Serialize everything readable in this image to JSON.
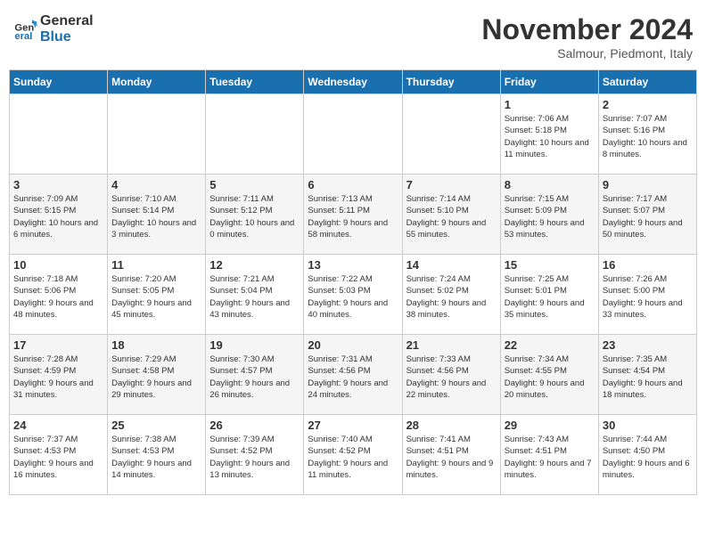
{
  "logo": {
    "line1": "General",
    "line2": "Blue"
  },
  "title": "November 2024",
  "location": "Salmour, Piedmont, Italy",
  "weekdays": [
    "Sunday",
    "Monday",
    "Tuesday",
    "Wednesday",
    "Thursday",
    "Friday",
    "Saturday"
  ],
  "weeks": [
    [
      {
        "day": "",
        "info": ""
      },
      {
        "day": "",
        "info": ""
      },
      {
        "day": "",
        "info": ""
      },
      {
        "day": "",
        "info": ""
      },
      {
        "day": "",
        "info": ""
      },
      {
        "day": "1",
        "info": "Sunrise: 7:06 AM\nSunset: 5:18 PM\nDaylight: 10 hours and 11 minutes."
      },
      {
        "day": "2",
        "info": "Sunrise: 7:07 AM\nSunset: 5:16 PM\nDaylight: 10 hours and 8 minutes."
      }
    ],
    [
      {
        "day": "3",
        "info": "Sunrise: 7:09 AM\nSunset: 5:15 PM\nDaylight: 10 hours and 6 minutes."
      },
      {
        "day": "4",
        "info": "Sunrise: 7:10 AM\nSunset: 5:14 PM\nDaylight: 10 hours and 3 minutes."
      },
      {
        "day": "5",
        "info": "Sunrise: 7:11 AM\nSunset: 5:12 PM\nDaylight: 10 hours and 0 minutes."
      },
      {
        "day": "6",
        "info": "Sunrise: 7:13 AM\nSunset: 5:11 PM\nDaylight: 9 hours and 58 minutes."
      },
      {
        "day": "7",
        "info": "Sunrise: 7:14 AM\nSunset: 5:10 PM\nDaylight: 9 hours and 55 minutes."
      },
      {
        "day": "8",
        "info": "Sunrise: 7:15 AM\nSunset: 5:09 PM\nDaylight: 9 hours and 53 minutes."
      },
      {
        "day": "9",
        "info": "Sunrise: 7:17 AM\nSunset: 5:07 PM\nDaylight: 9 hours and 50 minutes."
      }
    ],
    [
      {
        "day": "10",
        "info": "Sunrise: 7:18 AM\nSunset: 5:06 PM\nDaylight: 9 hours and 48 minutes."
      },
      {
        "day": "11",
        "info": "Sunrise: 7:20 AM\nSunset: 5:05 PM\nDaylight: 9 hours and 45 minutes."
      },
      {
        "day": "12",
        "info": "Sunrise: 7:21 AM\nSunset: 5:04 PM\nDaylight: 9 hours and 43 minutes."
      },
      {
        "day": "13",
        "info": "Sunrise: 7:22 AM\nSunset: 5:03 PM\nDaylight: 9 hours and 40 minutes."
      },
      {
        "day": "14",
        "info": "Sunrise: 7:24 AM\nSunset: 5:02 PM\nDaylight: 9 hours and 38 minutes."
      },
      {
        "day": "15",
        "info": "Sunrise: 7:25 AM\nSunset: 5:01 PM\nDaylight: 9 hours and 35 minutes."
      },
      {
        "day": "16",
        "info": "Sunrise: 7:26 AM\nSunset: 5:00 PM\nDaylight: 9 hours and 33 minutes."
      }
    ],
    [
      {
        "day": "17",
        "info": "Sunrise: 7:28 AM\nSunset: 4:59 PM\nDaylight: 9 hours and 31 minutes."
      },
      {
        "day": "18",
        "info": "Sunrise: 7:29 AM\nSunset: 4:58 PM\nDaylight: 9 hours and 29 minutes."
      },
      {
        "day": "19",
        "info": "Sunrise: 7:30 AM\nSunset: 4:57 PM\nDaylight: 9 hours and 26 minutes."
      },
      {
        "day": "20",
        "info": "Sunrise: 7:31 AM\nSunset: 4:56 PM\nDaylight: 9 hours and 24 minutes."
      },
      {
        "day": "21",
        "info": "Sunrise: 7:33 AM\nSunset: 4:56 PM\nDaylight: 9 hours and 22 minutes."
      },
      {
        "day": "22",
        "info": "Sunrise: 7:34 AM\nSunset: 4:55 PM\nDaylight: 9 hours and 20 minutes."
      },
      {
        "day": "23",
        "info": "Sunrise: 7:35 AM\nSunset: 4:54 PM\nDaylight: 9 hours and 18 minutes."
      }
    ],
    [
      {
        "day": "24",
        "info": "Sunrise: 7:37 AM\nSunset: 4:53 PM\nDaylight: 9 hours and 16 minutes."
      },
      {
        "day": "25",
        "info": "Sunrise: 7:38 AM\nSunset: 4:53 PM\nDaylight: 9 hours and 14 minutes."
      },
      {
        "day": "26",
        "info": "Sunrise: 7:39 AM\nSunset: 4:52 PM\nDaylight: 9 hours and 13 minutes."
      },
      {
        "day": "27",
        "info": "Sunrise: 7:40 AM\nSunset: 4:52 PM\nDaylight: 9 hours and 11 minutes."
      },
      {
        "day": "28",
        "info": "Sunrise: 7:41 AM\nSunset: 4:51 PM\nDaylight: 9 hours and 9 minutes."
      },
      {
        "day": "29",
        "info": "Sunrise: 7:43 AM\nSunset: 4:51 PM\nDaylight: 9 hours and 7 minutes."
      },
      {
        "day": "30",
        "info": "Sunrise: 7:44 AM\nSunset: 4:50 PM\nDaylight: 9 hours and 6 minutes."
      }
    ]
  ]
}
